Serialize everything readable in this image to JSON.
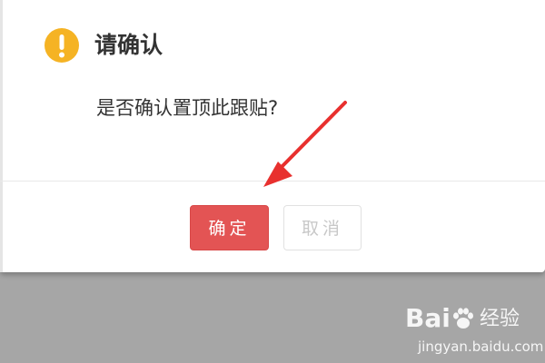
{
  "dialog": {
    "title": "请确认",
    "message": "是否确认置顶此跟贴?",
    "confirm_label": "确定",
    "cancel_label": "取消"
  },
  "icons": {
    "warning": "exclamation-circle-icon",
    "pointer": "red-arrow-icon"
  },
  "watermark": {
    "logo_text": "Bai",
    "brand": "经验",
    "url": "jingyan.baidu.com"
  },
  "colors": {
    "warning": "#f5b324",
    "confirm_button": "#e35454",
    "arrow": "#e8302e",
    "overlay": "#a6a6a6"
  }
}
